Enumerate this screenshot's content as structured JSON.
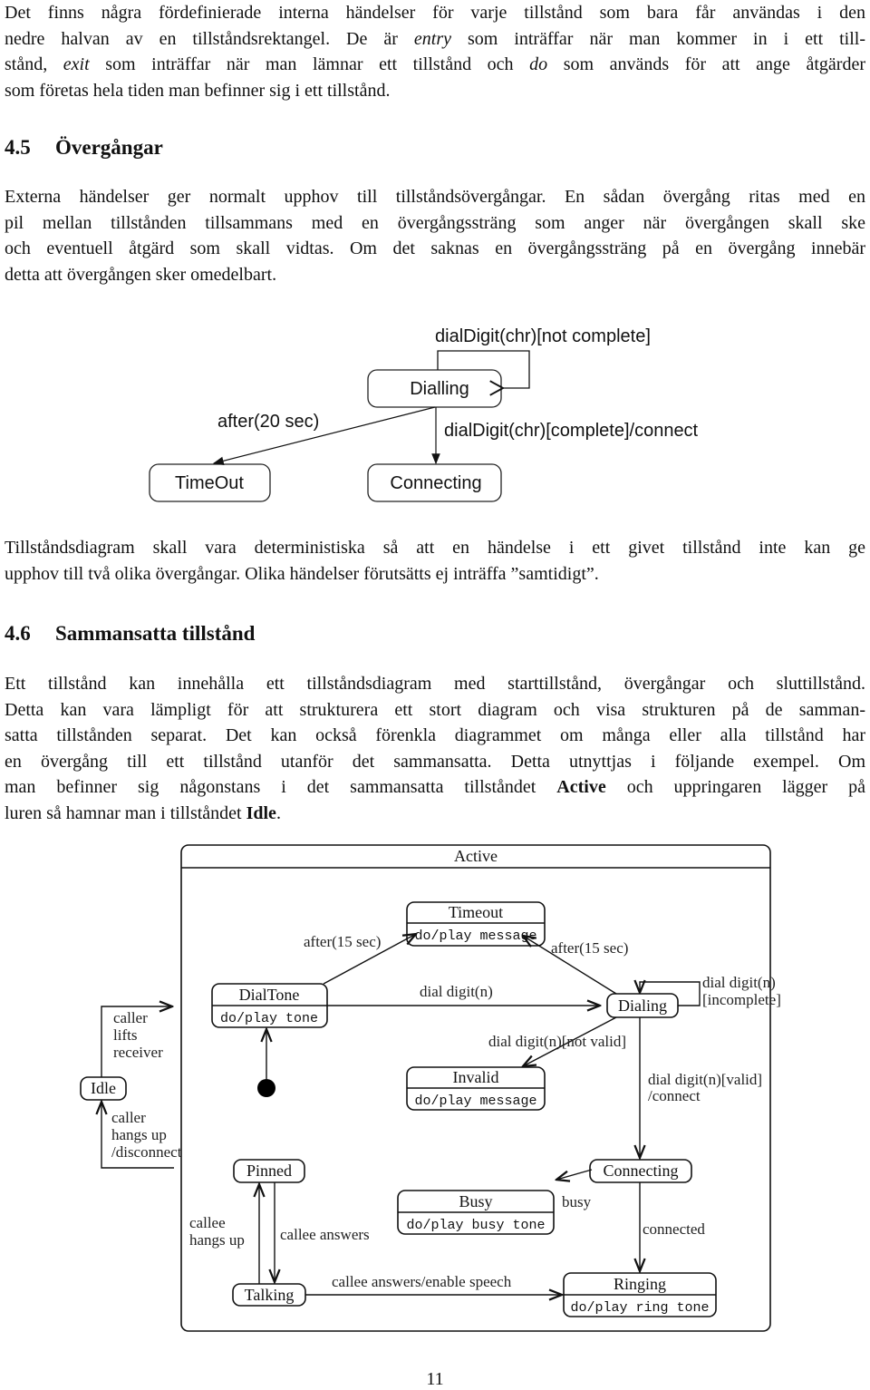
{
  "paragraphs": {
    "intro": [
      [
        {
          "t": "Det finns några fördefinierade interna händelser för varje tillstånd som bara får användas i den"
        }
      ],
      [
        {
          "t": "nedre halvan av en tillståndsrektangel. De är "
        },
        {
          "t": "entry",
          "s": "i"
        },
        {
          "t": " som inträffar när man kommer in i ett till-"
        }
      ],
      [
        {
          "t": "stånd, "
        },
        {
          "t": "exit",
          "s": "i"
        },
        {
          "t": " som inträffar när man lämnar ett tillstånd och "
        },
        {
          "t": "do",
          "s": "i"
        },
        {
          "t": " som används för att ange åtgärder"
        }
      ],
      [
        {
          "t": "som företas hela tiden man befinner sig i ett tillstånd."
        }
      ]
    ],
    "transitions": [
      [
        {
          "t": "Externa händelser ger normalt upphov till tillståndsövergångar. En sådan övergång ritas med en"
        }
      ],
      [
        {
          "t": "pil mellan tillstånden tillsammans med en övergångssträng som anger när övergången skall ske"
        }
      ],
      [
        {
          "t": "och eventuell åtgärd som skall vidtas. Om det saknas en övergångssträng på en övergång innebär"
        }
      ],
      [
        {
          "t": "detta att övergången sker omedelbart."
        }
      ]
    ],
    "deterministic": [
      [
        {
          "t": "Tillståndsdiagram skall vara deterministiska så att en händelse i ett givet tillstånd inte kan ge"
        }
      ],
      [
        {
          "t": "upphov till två olika övergångar. Olika händelser förutsätts ej inträffa ”samtidigt”."
        }
      ]
    ],
    "composite": [
      [
        {
          "t": "Ett tillstånd kan innehålla ett tillståndsdiagram med starttillstånd, övergångar och sluttillstånd."
        }
      ],
      [
        {
          "t": "Detta kan vara lämpligt för att strukturera ett stort diagram och visa strukturen på de samman-"
        }
      ],
      [
        {
          "t": "satta tillstånden separat. Det kan också förenkla diagrammet om många eller alla tillstånd har"
        }
      ],
      [
        {
          "t": "en övergång till ett tillstånd utanför det sammansatta. Detta utnyttjas i följande exempel. Om"
        }
      ],
      [
        {
          "t": "man befinner sig någonstans i det sammansatta tillståndet "
        },
        {
          "t": "Active",
          "s": "b"
        },
        {
          "t": " och uppringaren lägger på"
        }
      ],
      [
        {
          "t": "luren så hamnar man i tillståndet "
        },
        {
          "t": "Idle",
          "s": "b"
        },
        {
          "t": "."
        }
      ]
    ]
  },
  "headings": {
    "s45": {
      "num": "4.5",
      "title": "Övergångar"
    },
    "s46": {
      "num": "4.6",
      "title": "Sammansatta tillstånd"
    }
  },
  "diagram1": {
    "states": {
      "dialling": "Dialling",
      "timeout": "TimeOut",
      "connecting": "Connecting"
    },
    "labels": {
      "self_loop": "dialDigit(chr)[not complete]",
      "to_timeout": "after(20 sec)",
      "to_connecting": "dialDigit(chr)[complete]/connect"
    }
  },
  "diagram2": {
    "composite": "Active",
    "states": {
      "timeout": {
        "name": "Timeout",
        "do": "do/play message"
      },
      "dialtone": {
        "name": "DialTone",
        "do": "do/play tone"
      },
      "dialing": {
        "name": "Dialing"
      },
      "invalid": {
        "name": "Invalid",
        "do": "do/play message"
      },
      "idle": {
        "name": "Idle"
      },
      "pinned": {
        "name": "Pinned"
      },
      "connecting": {
        "name": "Connecting"
      },
      "busy": {
        "name": "Busy",
        "do": "do/play busy tone"
      },
      "talking": {
        "name": "Talking"
      },
      "ringing": {
        "name": "Ringing",
        "do": "do/play ring tone"
      }
    },
    "labels": {
      "after1": "after(15 sec)",
      "after2": "after(15 sec)",
      "dial_digit": "dial digit(n)",
      "incomplete1": "dial digit(n)",
      "incomplete2": "[incomplete]",
      "not_valid": "dial digit(n)[not valid]",
      "valid1": "dial digit(n)[valid]",
      "valid2": "/connect",
      "lifts": [
        "caller",
        "lifts",
        "receiver"
      ],
      "hangs": [
        "caller",
        "hangs up",
        "/disconnect"
      ],
      "busy": "busy",
      "connected": "connected",
      "callee_hangs": [
        "callee",
        "hangs up"
      ],
      "callee_answers": "callee answers",
      "enable_speech": "callee answers/enable speech"
    }
  },
  "page_number": "11"
}
